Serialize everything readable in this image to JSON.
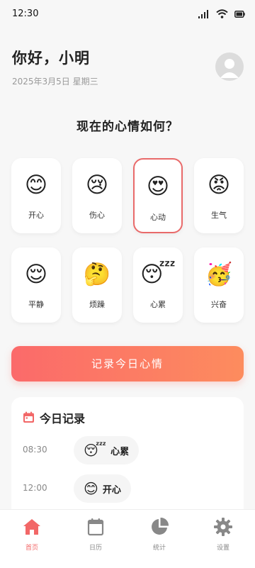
{
  "status": {
    "time": "12:30"
  },
  "header": {
    "greeting": "你好，小明",
    "date": "2025年3月5日 星期三"
  },
  "question": "现在的心情如何？",
  "moods": [
    {
      "emoji": "😊",
      "label": "开心",
      "selected": false
    },
    {
      "emoji": "😢",
      "label": "伤心",
      "selected": false
    },
    {
      "emoji": "😍",
      "label": "心动",
      "selected": true
    },
    {
      "emoji": "😡",
      "label": "生气",
      "selected": false
    },
    {
      "emoji": "😌",
      "label": "平静",
      "selected": false
    },
    {
      "emoji": "🤔",
      "label": "烦躁",
      "selected": false
    },
    {
      "emoji": "😴",
      "label": "心累",
      "selected": false
    },
    {
      "emoji": "🥳",
      "label": "兴奋",
      "selected": false
    }
  ],
  "record_button": "记录今日心情",
  "today": {
    "title": "今日记录",
    "entries": [
      {
        "time": "08:30",
        "emoji": "😴",
        "label": "心累"
      },
      {
        "time": "12:00",
        "emoji": "😊",
        "label": "开心"
      }
    ]
  },
  "tabs": [
    {
      "label": "首页",
      "icon": "home-icon",
      "active": true
    },
    {
      "label": "日历",
      "icon": "calendar-icon",
      "active": false
    },
    {
      "label": "统计",
      "icon": "pie-chart-icon",
      "active": false
    },
    {
      "label": "设置",
      "icon": "gear-icon",
      "active": false
    }
  ],
  "colors": {
    "accent": "#f26767",
    "gradient_start": "#fb6a6a",
    "gradient_end": "#fd8c5e",
    "inactive": "#888888"
  }
}
